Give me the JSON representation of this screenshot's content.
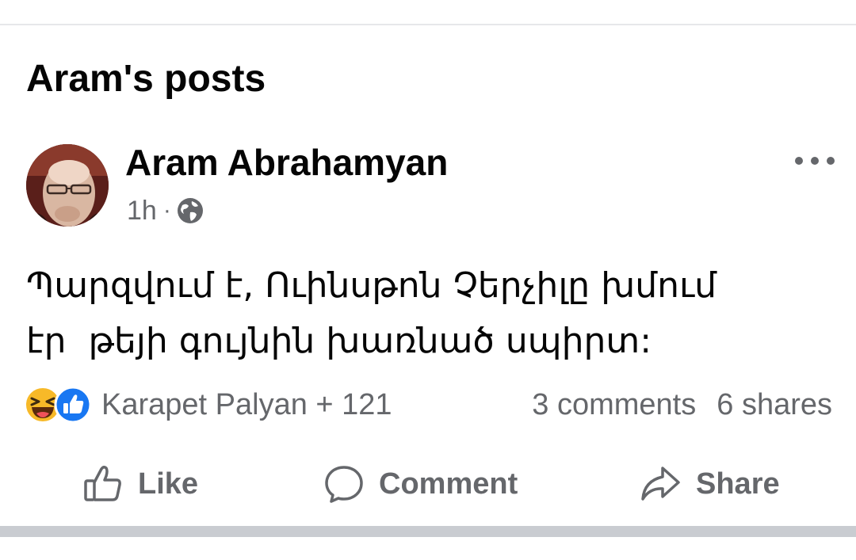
{
  "section": {
    "title": "Aram's posts"
  },
  "post": {
    "author": "Aram Abrahamyan",
    "time": "1h",
    "separator": "·",
    "privacy_icon": "globe-icon",
    "more_icon": "more-horizontal-icon",
    "text_lines": [
      "Պարզվում է, Ուինսթոն Չերչիլը խմում",
      "էր  թեյի գույնին խառնած սպիրտ:"
    ],
    "reactions": {
      "icons": [
        "laugh-emoji-icon",
        "like-reaction-icon"
      ],
      "summary": "Karapet Palyan + 121",
      "comments": "3 comments",
      "shares": "6 shares"
    },
    "actions": {
      "like": "Like",
      "comment": "Comment",
      "share": "Share"
    }
  },
  "colors": {
    "text_primary": "#050505",
    "text_secondary": "#65676b",
    "like_blue": "#1877f2",
    "laugh_yellow": "#f7b928",
    "divider": "#c9ccd1"
  }
}
